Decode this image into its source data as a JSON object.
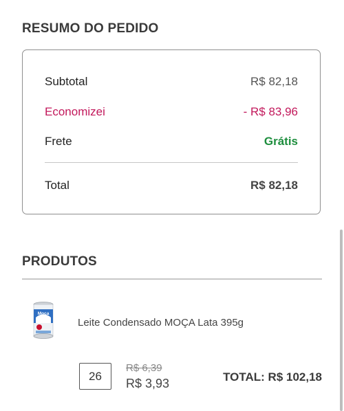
{
  "summary": {
    "title": "RESUMO DO PEDIDO",
    "subtotal_label": "Subtotal",
    "subtotal_value": "R$ 82,18",
    "savings_label": "Economizei",
    "savings_value": "- R$ 83,96",
    "shipping_label": "Frete",
    "shipping_value": "Grátis",
    "total_label": "Total",
    "total_value": "R$ 82,18"
  },
  "products": {
    "title": "PRODUTOS",
    "items": [
      {
        "name": "Leite Condensado MOÇA Lata 395g",
        "quantity": "26",
        "old_price": "R$ 6,39",
        "price": "R$ 3,93",
        "total": "TOTAL: R$ 102,18",
        "image_brand_text": "Moça"
      }
    ]
  },
  "colors": {
    "savings": "#c2185b",
    "free_shipping": "#1e8e3e",
    "border": "#8e8e8e"
  }
}
